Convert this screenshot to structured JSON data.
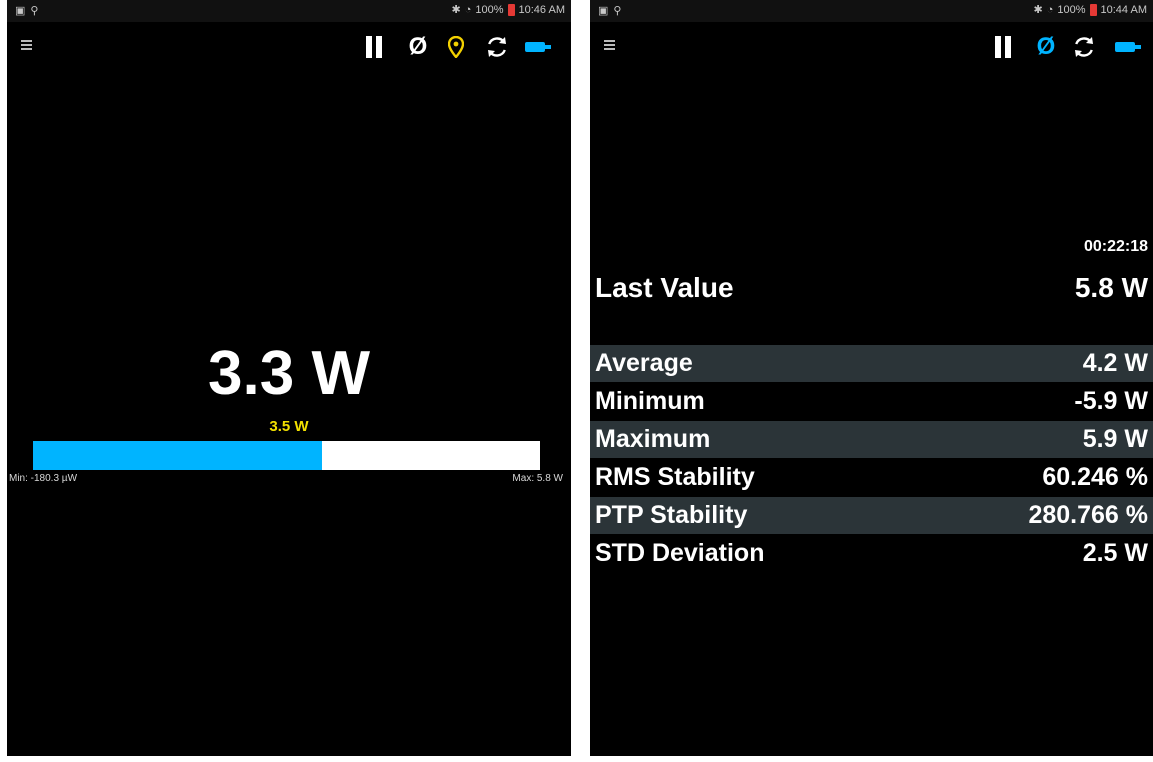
{
  "left": {
    "status": {
      "battery": "100%",
      "time": "10:46 AM"
    },
    "toolbar": {
      "zero_label": "Ø"
    },
    "reading": "3.3 W",
    "bar": {
      "label": "3.5 W",
      "fill_fraction": 0.57,
      "min": "Min: -180.3 µW",
      "max": "Max: 5.8 W"
    }
  },
  "right": {
    "status": {
      "battery": "100%",
      "time": "10:44 AM"
    },
    "toolbar": {
      "zero_label": "Ø"
    },
    "elapsed": "00:22:18",
    "last": {
      "label": "Last Value",
      "value": "5.8 W"
    },
    "stats": [
      {
        "label": "Average",
        "value": "4.2 W"
      },
      {
        "label": "Minimum",
        "value": "-5.9 W"
      },
      {
        "label": "Maximum",
        "value": "5.9 W"
      },
      {
        "label": "RMS Stability",
        "value": "60.246 %"
      },
      {
        "label": "PTP Stability",
        "value": "280.766 %"
      },
      {
        "label": "STD Deviation",
        "value": "2.5 W"
      }
    ]
  },
  "colors": {
    "accent_blue": "#00b4ff",
    "pin_yellow": "#f2d000",
    "label_yellow": "#f2e000",
    "row_shade": "#2b3438"
  },
  "icons": [
    "menu-icon",
    "pause-icon",
    "zero-icon",
    "location-pin-icon",
    "refresh-icon",
    "probe-icon",
    "bluetooth-icon",
    "wifi-icon",
    "battery-icon"
  ]
}
